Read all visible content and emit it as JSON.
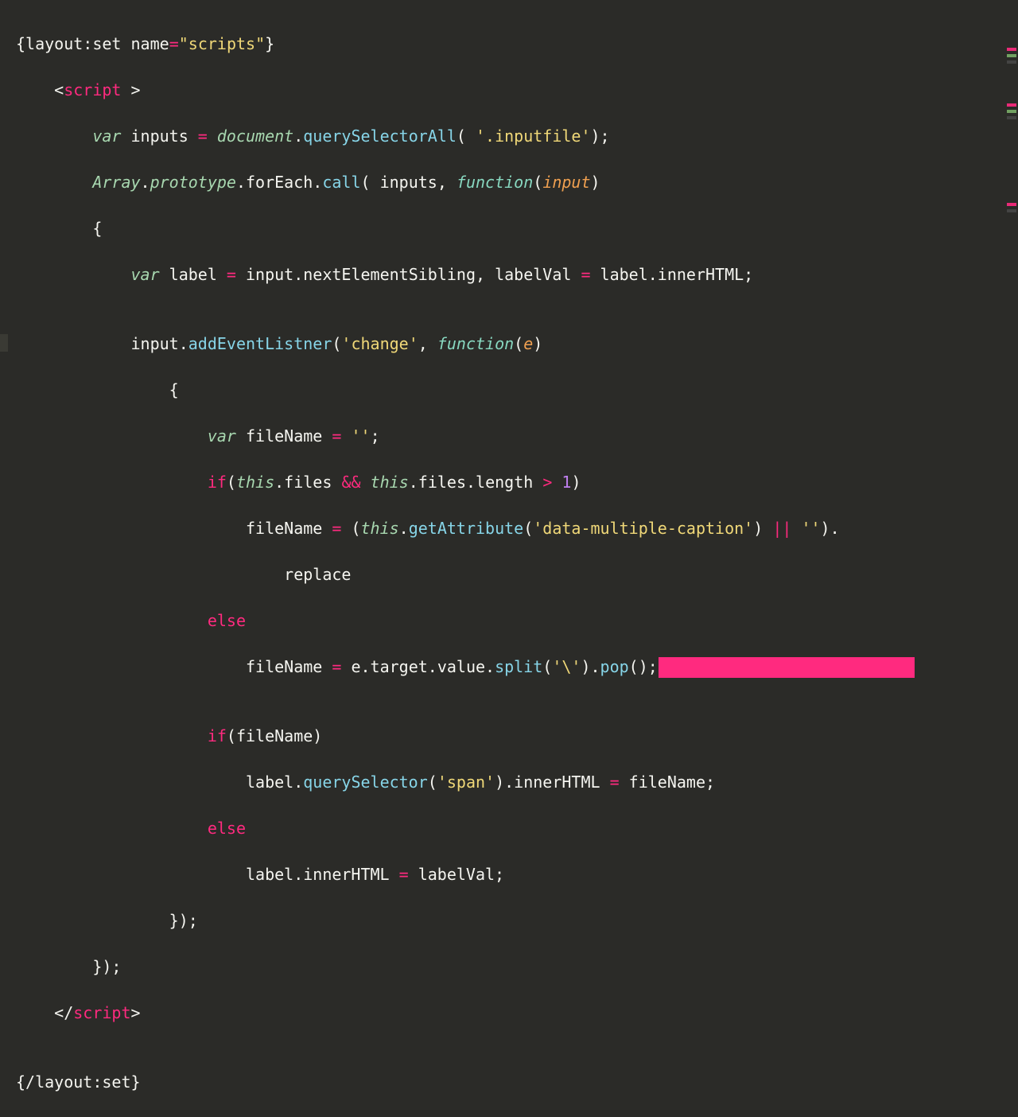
{
  "colors": {
    "background": "#2b2b28",
    "foreground": "#e8e8e0",
    "pink": "#ff2a7f",
    "italicGreen": "#a8d8b0",
    "green": "#92d47a",
    "yellow": "#f0d878",
    "blue": "#87d5e8",
    "orange": "#f0a050",
    "purple": "#c080f0",
    "selection": "#ff2a7f"
  },
  "code": {
    "l1": {
      "a": "{",
      "b": "layout:set",
      "c": " name",
      "d": "=",
      "e": "\"scripts\"",
      "f": "}"
    },
    "l2": {
      "a": "    <",
      "b": "script",
      "c": " >"
    },
    "l3": {
      "a": "        ",
      "b": "var",
      "c": " inputs ",
      "d": "=",
      "e": " ",
      "f": "document",
      "g": ".",
      "h": "querySelectorAll",
      "i": "( ",
      "j": "'.inputfile'",
      "k": ");"
    },
    "l4": {
      "a": "        ",
      "b": "Array",
      "c": ".",
      "d": "prototype",
      "e": ".forEach.",
      "f": "call",
      "g": "( inputs, ",
      "h": "function",
      "i": "(",
      "j": "input",
      "k": ")"
    },
    "l5": {
      "a": "        {"
    },
    "l6": {
      "a": "            ",
      "b": "var",
      "c": " label ",
      "d": "=",
      "e": " input.nextElementSibling, labelVal ",
      "f": "=",
      "g": " label.innerHTML;"
    },
    "l7": {
      "a": ""
    },
    "l8": {
      "a": "            input.",
      "b": "addEventListner",
      "c": "(",
      "d": "'change'",
      "e": ", ",
      "f": "function",
      "g": "(",
      "h": "e",
      "i": ")"
    },
    "l9": {
      "a": "                {"
    },
    "l10": {
      "a": "                    ",
      "b": "var",
      "c": " fileName ",
      "d": "=",
      "e": " ",
      "f": "''",
      "g": ";"
    },
    "l11": {
      "a": "                    ",
      "b": "if",
      "c": "(",
      "d": "this",
      "e": ".files ",
      "f": "&&",
      "g": " ",
      "h": "this",
      "i": ".files.length ",
      "j": ">",
      "k": " ",
      "l": "1",
      "m": ")"
    },
    "l12": {
      "a": "                        fileName ",
      "b": "=",
      "c": " (",
      "d": "this",
      "e": ".",
      "f": "getAttribute",
      "g": "(",
      "h": "'data-multiple-caption'",
      "i": ") ",
      "j": "||",
      "k": " ",
      "l": "''",
      "m": ")."
    },
    "l13": {
      "a": "                            replace"
    },
    "l14": {
      "a": "                    ",
      "b": "else"
    },
    "l15": {
      "a": "                        fileName ",
      "b": "=",
      "c": " e.target.value.",
      "d": "split",
      "e": "(",
      "f": "'\\'",
      "g": ").",
      "h": "pop",
      "i": "();"
    },
    "l16": {
      "a": ""
    },
    "l17": {
      "a": "                    ",
      "b": "if",
      "c": "(fileName)"
    },
    "l18": {
      "a": "                        label.",
      "b": "querySelector",
      "c": "(",
      "d": "'span'",
      "e": ").innerHTML ",
      "f": "=",
      "g": " fileName;"
    },
    "l19": {
      "a": "                    ",
      "b": "else"
    },
    "l20": {
      "a": "                        label.innerHTML ",
      "b": "=",
      "c": " labelVal;"
    },
    "l21": {
      "a": "                });"
    },
    "l22": {
      "a": "        });"
    },
    "l23": {
      "a": "    </",
      "b": "script",
      "c": ">"
    },
    "l24": {
      "a": ""
    },
    "l25": {
      "a": "{/",
      "b": "layout:set",
      "c": "}"
    }
  }
}
